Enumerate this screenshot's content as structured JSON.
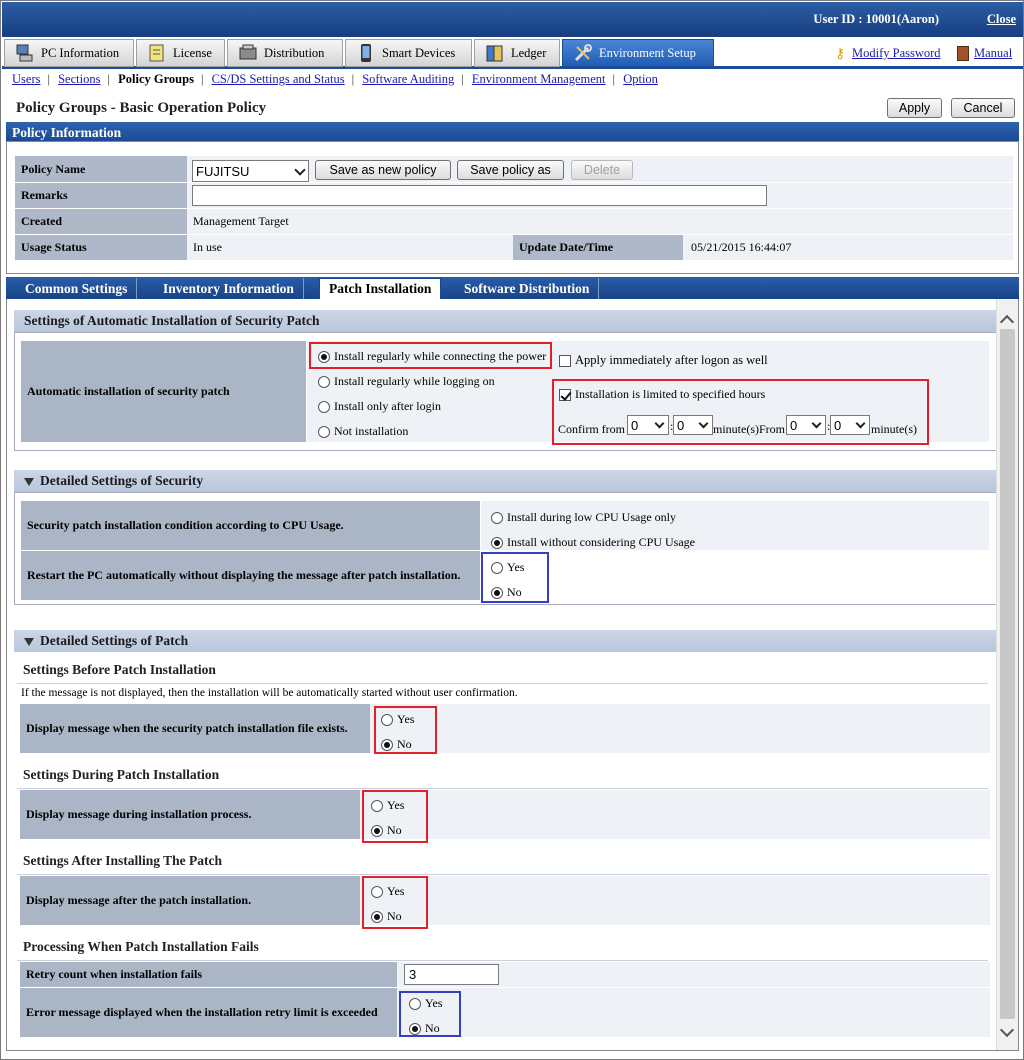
{
  "header": {
    "user_id": "User ID : 10001(Aaron)",
    "close": "Close"
  },
  "menu": {
    "tabs": [
      {
        "label": "PC Information",
        "icon": "pc-icon"
      },
      {
        "label": "License",
        "icon": "license-icon"
      },
      {
        "label": "Distribution",
        "icon": "distribution-icon"
      },
      {
        "label": "Smart Devices",
        "icon": "smart-device-icon"
      },
      {
        "label": "Ledger",
        "icon": "ledger-icon"
      },
      {
        "label": "Environment Setup",
        "icon": "tools-icon"
      }
    ],
    "modify_password": "Modify Password",
    "manual": "Manual"
  },
  "submenu": [
    "Users",
    "Sections",
    "Policy Groups",
    "CS/DS Settings and Status",
    "Software Auditing",
    "Environment Management",
    "Option"
  ],
  "page": {
    "title": "Policy Groups - Basic Operation Policy",
    "apply": "Apply",
    "cancel": "Cancel"
  },
  "policy_info": {
    "header": "Policy Information",
    "policy_name_label": "Policy Name",
    "policy_name_value": "FUJITSU",
    "save_new": "Save as new policy",
    "save_as": "Save policy as",
    "delete": "Delete",
    "remarks_label": "Remarks",
    "remarks_value": "",
    "created_label": "Created",
    "created_value": "Management Target",
    "usage_label": "Usage Status",
    "usage_value": "In use",
    "update_label": "Update Date/Time",
    "update_value": "05/21/2015 16:44:07"
  },
  "tabs2": [
    "Common Settings",
    "Inventory Information",
    "Patch Installation",
    "Software Distribution"
  ],
  "auto": {
    "header": "Settings of Automatic Installation of Security Patch",
    "label": "Automatic installation of security patch",
    "options": [
      "Install regularly while connecting the power",
      "Install regularly while logging on",
      "Install only after login",
      "Not installation"
    ],
    "apply_logon": "Apply immediately after logon as well",
    "limited_hours": "Installation is limited to specified hours",
    "confirm_from": "Confirm from",
    "minutes_from": "minute(s)From",
    "minutes": "minute(s)",
    "sel": [
      "0",
      "0",
      "0",
      "0"
    ]
  },
  "security": {
    "header": "Detailed Settings of Security",
    "cpu_label": "Security patch installation condition according to CPU Usage.",
    "cpu_options": [
      "Install during low CPU Usage only",
      "Install without considering CPU Usage"
    ],
    "restart_label": "Restart the PC automatically without displaying the message after patch installation.",
    "yes": "Yes",
    "no": "No"
  },
  "patch": {
    "header": "Detailed Settings of Patch",
    "before_title": "Settings Before Patch Installation",
    "before_note": "If the message is not displayed, then the installation will be automatically started without user confirmation.",
    "before_label": "Display message when the security patch installation file exists.",
    "during_title": "Settings During Patch Installation",
    "during_label": "Display message during installation process.",
    "after_title": "Settings After Installing The Patch",
    "after_label": "Display message after the patch installation.",
    "fail_title": "Processing When Patch Installation Fails",
    "retry_label": "Retry count when installation fails",
    "retry_value": "3",
    "error_label": "Error message displayed when the installation retry limit is exceeded"
  }
}
